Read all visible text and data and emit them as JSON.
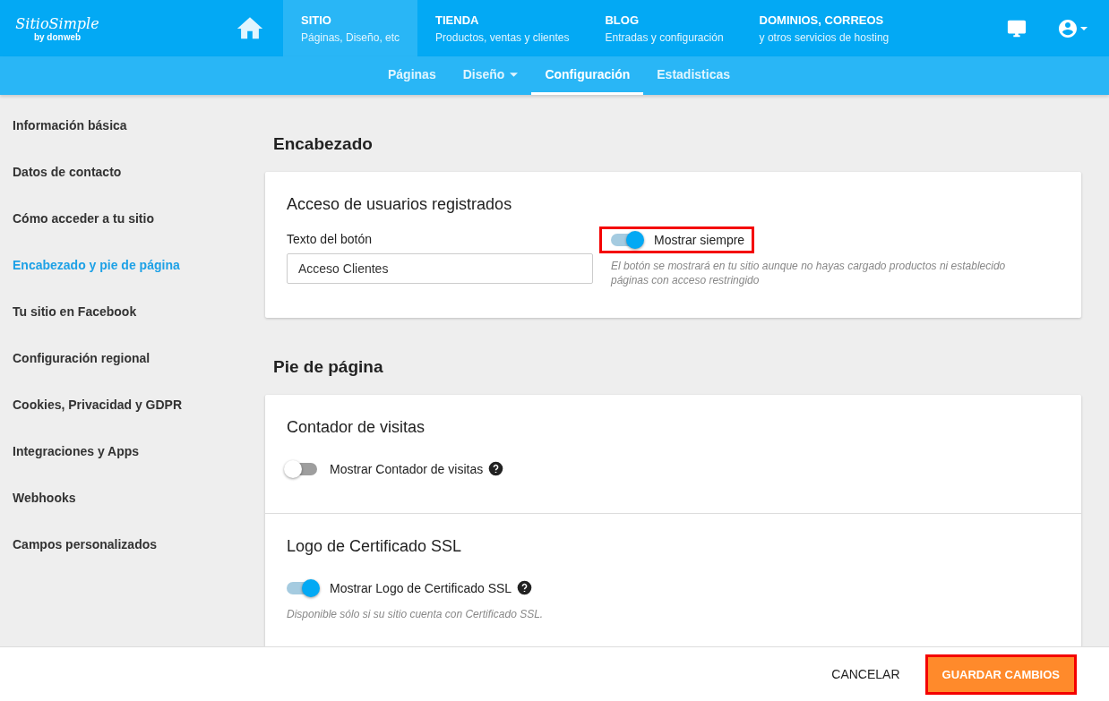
{
  "logo": {
    "name": "SitioSimple",
    "byline": "by donweb"
  },
  "top_tabs": [
    {
      "title": "SITIO",
      "subtitle": "Páginas, Diseño, etc",
      "selected": true
    },
    {
      "title": "TIENDA",
      "subtitle": "Productos, ventas y clientes",
      "selected": false
    },
    {
      "title": "BLOG",
      "subtitle": "Entradas y configuración",
      "selected": false
    },
    {
      "title": "DOMINIOS, CORREOS",
      "subtitle": "y otros servicios de hosting",
      "selected": false
    }
  ],
  "sub_tabs": [
    {
      "label": "Páginas",
      "selected": false,
      "dropdown": false
    },
    {
      "label": "Diseño",
      "selected": false,
      "dropdown": true
    },
    {
      "label": "Configuración",
      "selected": true,
      "dropdown": false
    },
    {
      "label": "Estadisticas",
      "selected": false,
      "dropdown": false
    }
  ],
  "sidebar": {
    "items": [
      {
        "label": "Información básica",
        "selected": false
      },
      {
        "label": "Datos de contacto",
        "selected": false
      },
      {
        "label": "Cómo acceder a tu sitio",
        "selected": false
      },
      {
        "label": "Encabezado y pie de página",
        "selected": true
      },
      {
        "label": "Tu sitio en Facebook",
        "selected": false
      },
      {
        "label": "Configuración regional",
        "selected": false
      },
      {
        "label": "Cookies, Privacidad y GDPR",
        "selected": false
      },
      {
        "label": "Integraciones y Apps",
        "selected": false
      },
      {
        "label": "Webhooks",
        "selected": false
      },
      {
        "label": "Campos personalizados",
        "selected": false
      }
    ]
  },
  "sections": [
    {
      "title": "Encabezado",
      "blocks": [
        {
          "title": "Acceso de usuarios registrados",
          "field": {
            "label": "Texto del botón",
            "value": "Acceso Clientes"
          },
          "toggle": {
            "label": "Mostrar siempre",
            "on": true,
            "help": false,
            "highlighted": true
          },
          "hint": "El botón se mostrará en tu sitio aunque no hayas cargado productos ni establecido páginas con acceso restringido"
        }
      ]
    },
    {
      "title": "Pie de página",
      "blocks": [
        {
          "title": "Contador de visitas",
          "toggle": {
            "label": "Mostrar Contador de visitas",
            "on": false,
            "help": true,
            "highlighted": false
          }
        },
        {
          "title": "Logo de Certificado SSL",
          "toggle": {
            "label": "Mostrar Logo de Certificado SSL",
            "on": true,
            "help": true,
            "highlighted": false
          },
          "hint": "Disponible sólo si su sitio cuenta con Certificado SSL."
        }
      ]
    }
  ],
  "footer": {
    "cancel": "CANCELAR",
    "save": {
      "label": "GUARDAR CAMBIOS",
      "highlighted": true
    }
  }
}
